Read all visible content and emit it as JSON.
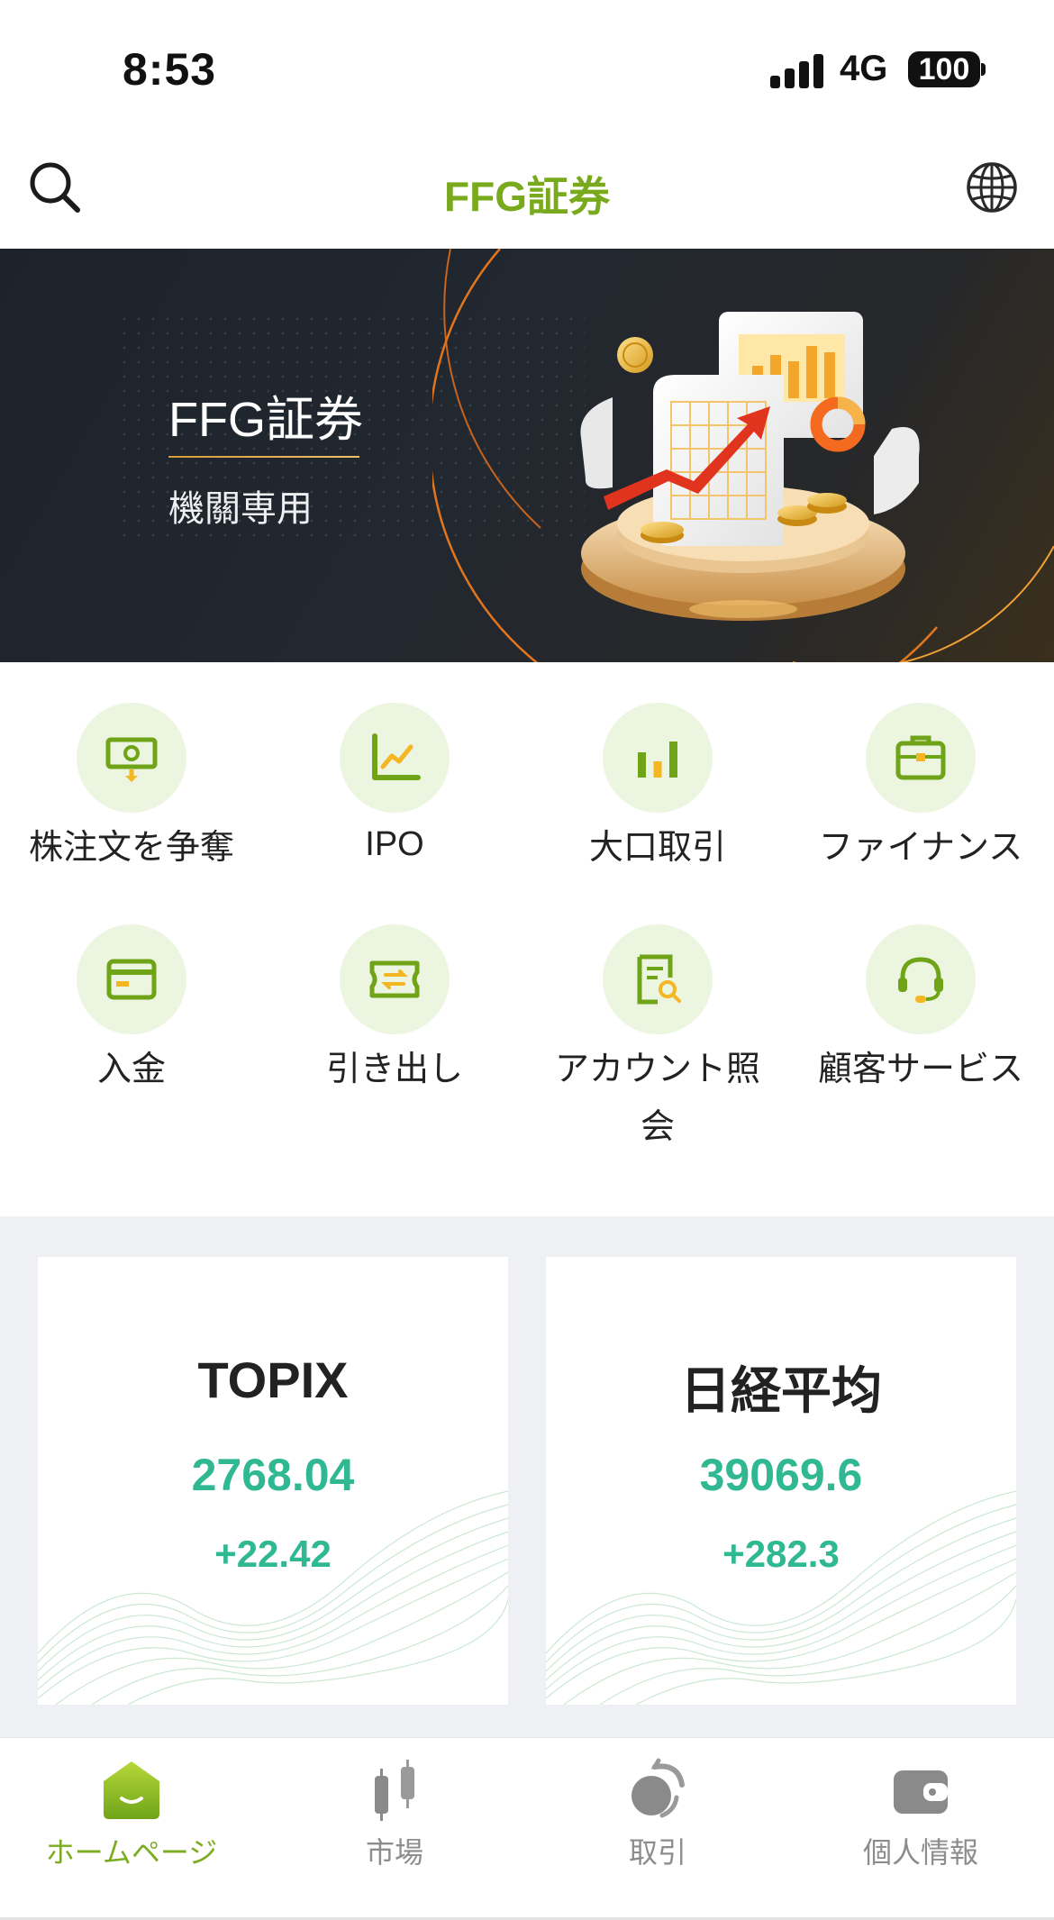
{
  "status_bar": {
    "time": "8:53",
    "network": "4G",
    "battery": "100"
  },
  "header": {
    "title": "FFG証券",
    "search_icon": "search-icon",
    "language_icon": "globe-icon"
  },
  "banner": {
    "title": "FFG証券",
    "subtitle": "機關専用"
  },
  "quick_actions": [
    {
      "label": "株注文を争奪",
      "icon": "cash-download-icon"
    },
    {
      "label": "IPO",
      "icon": "line-chart-icon"
    },
    {
      "label": "大口取引",
      "icon": "bar-chart-icon"
    },
    {
      "label": "ファイナンス",
      "icon": "briefcase-icon"
    },
    {
      "label": "入金",
      "icon": "credit-card-icon"
    },
    {
      "label": "引き出し",
      "icon": "transfer-ticket-icon"
    },
    {
      "label": "アカウント照会",
      "icon": "document-search-icon"
    },
    {
      "label": "顧客サービス",
      "icon": "headset-icon"
    }
  ],
  "markets": [
    {
      "name": "TOPIX",
      "value": "2768.04",
      "change": "+22.42"
    },
    {
      "name": "日経平均",
      "value": "39069.6",
      "change": "+282.3"
    }
  ],
  "tab_bar": {
    "active": "home",
    "items": [
      {
        "label": "ホームページ",
        "icon": "home-icon"
      },
      {
        "label": "市場",
        "icon": "candlestick-icon"
      },
      {
        "label": "取引",
        "icon": "trade-cycle-icon"
      },
      {
        "label": "個人情報",
        "icon": "wallet-icon"
      }
    ]
  },
  "colors": {
    "brand_green": "#79a91c",
    "up_green": "#2fb892",
    "icon_circle": "#ecf5df",
    "icon_stroke": "#6fa418",
    "icon_accent": "#f5b623"
  }
}
